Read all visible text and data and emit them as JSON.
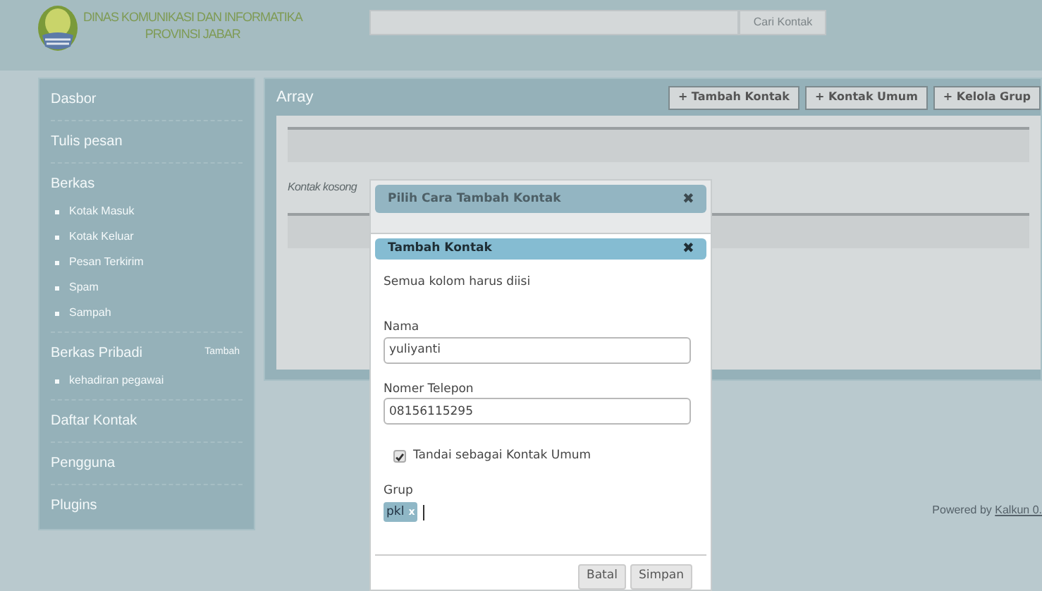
{
  "header": {
    "org_line_1": "DINAS KOMUNIKASI DAN INFORMATIKA",
    "org_line_2": "PROVINSI JABAR",
    "search_button": "Cari Kontak"
  },
  "sidebar": {
    "items": [
      {
        "label": "Dasbor"
      },
      {
        "label": "Tulis pesan"
      },
      {
        "label": "Berkas",
        "children": [
          {
            "label": "Kotak Masuk"
          },
          {
            "label": "Kotak Keluar"
          },
          {
            "label": "Pesan Terkirim"
          },
          {
            "label": "Spam"
          },
          {
            "label": "Sampah"
          }
        ]
      },
      {
        "label": "Berkas Pribadi",
        "action": "Tambah",
        "children": [
          {
            "label": "kehadiran pegawai"
          }
        ]
      },
      {
        "label": "Daftar Kontak"
      },
      {
        "label": "Pengguna"
      },
      {
        "label": "Plugins"
      }
    ]
  },
  "main": {
    "title": "Array",
    "buttons": [
      "+ Tambah Kontak",
      "+ Kontak Umum",
      "+ Kelola Grup"
    ],
    "empty_text": "Kontak kosong"
  },
  "footer": {
    "text": "Powered by ",
    "link": "Kalkun 0."
  },
  "dialog_back": {
    "title": "Pilih Cara Tambah Kontak",
    "close": "✖"
  },
  "dialog": {
    "title": "Tambah Kontak",
    "close": "✖",
    "note": "Semua kolom harus diisi",
    "fields": [
      {
        "label": "Nama",
        "value": "yuliyanti"
      },
      {
        "label": "Nomer Telepon",
        "value": "08156115295"
      }
    ],
    "checkbox": {
      "label": "Tandai sebagai Kontak Umum",
      "checked": true
    },
    "group": {
      "label": "Grup",
      "tags": [
        {
          "label": "pkl",
          "remove": "x"
        }
      ]
    },
    "buttons": [
      "Batal",
      "Simpan"
    ]
  }
}
